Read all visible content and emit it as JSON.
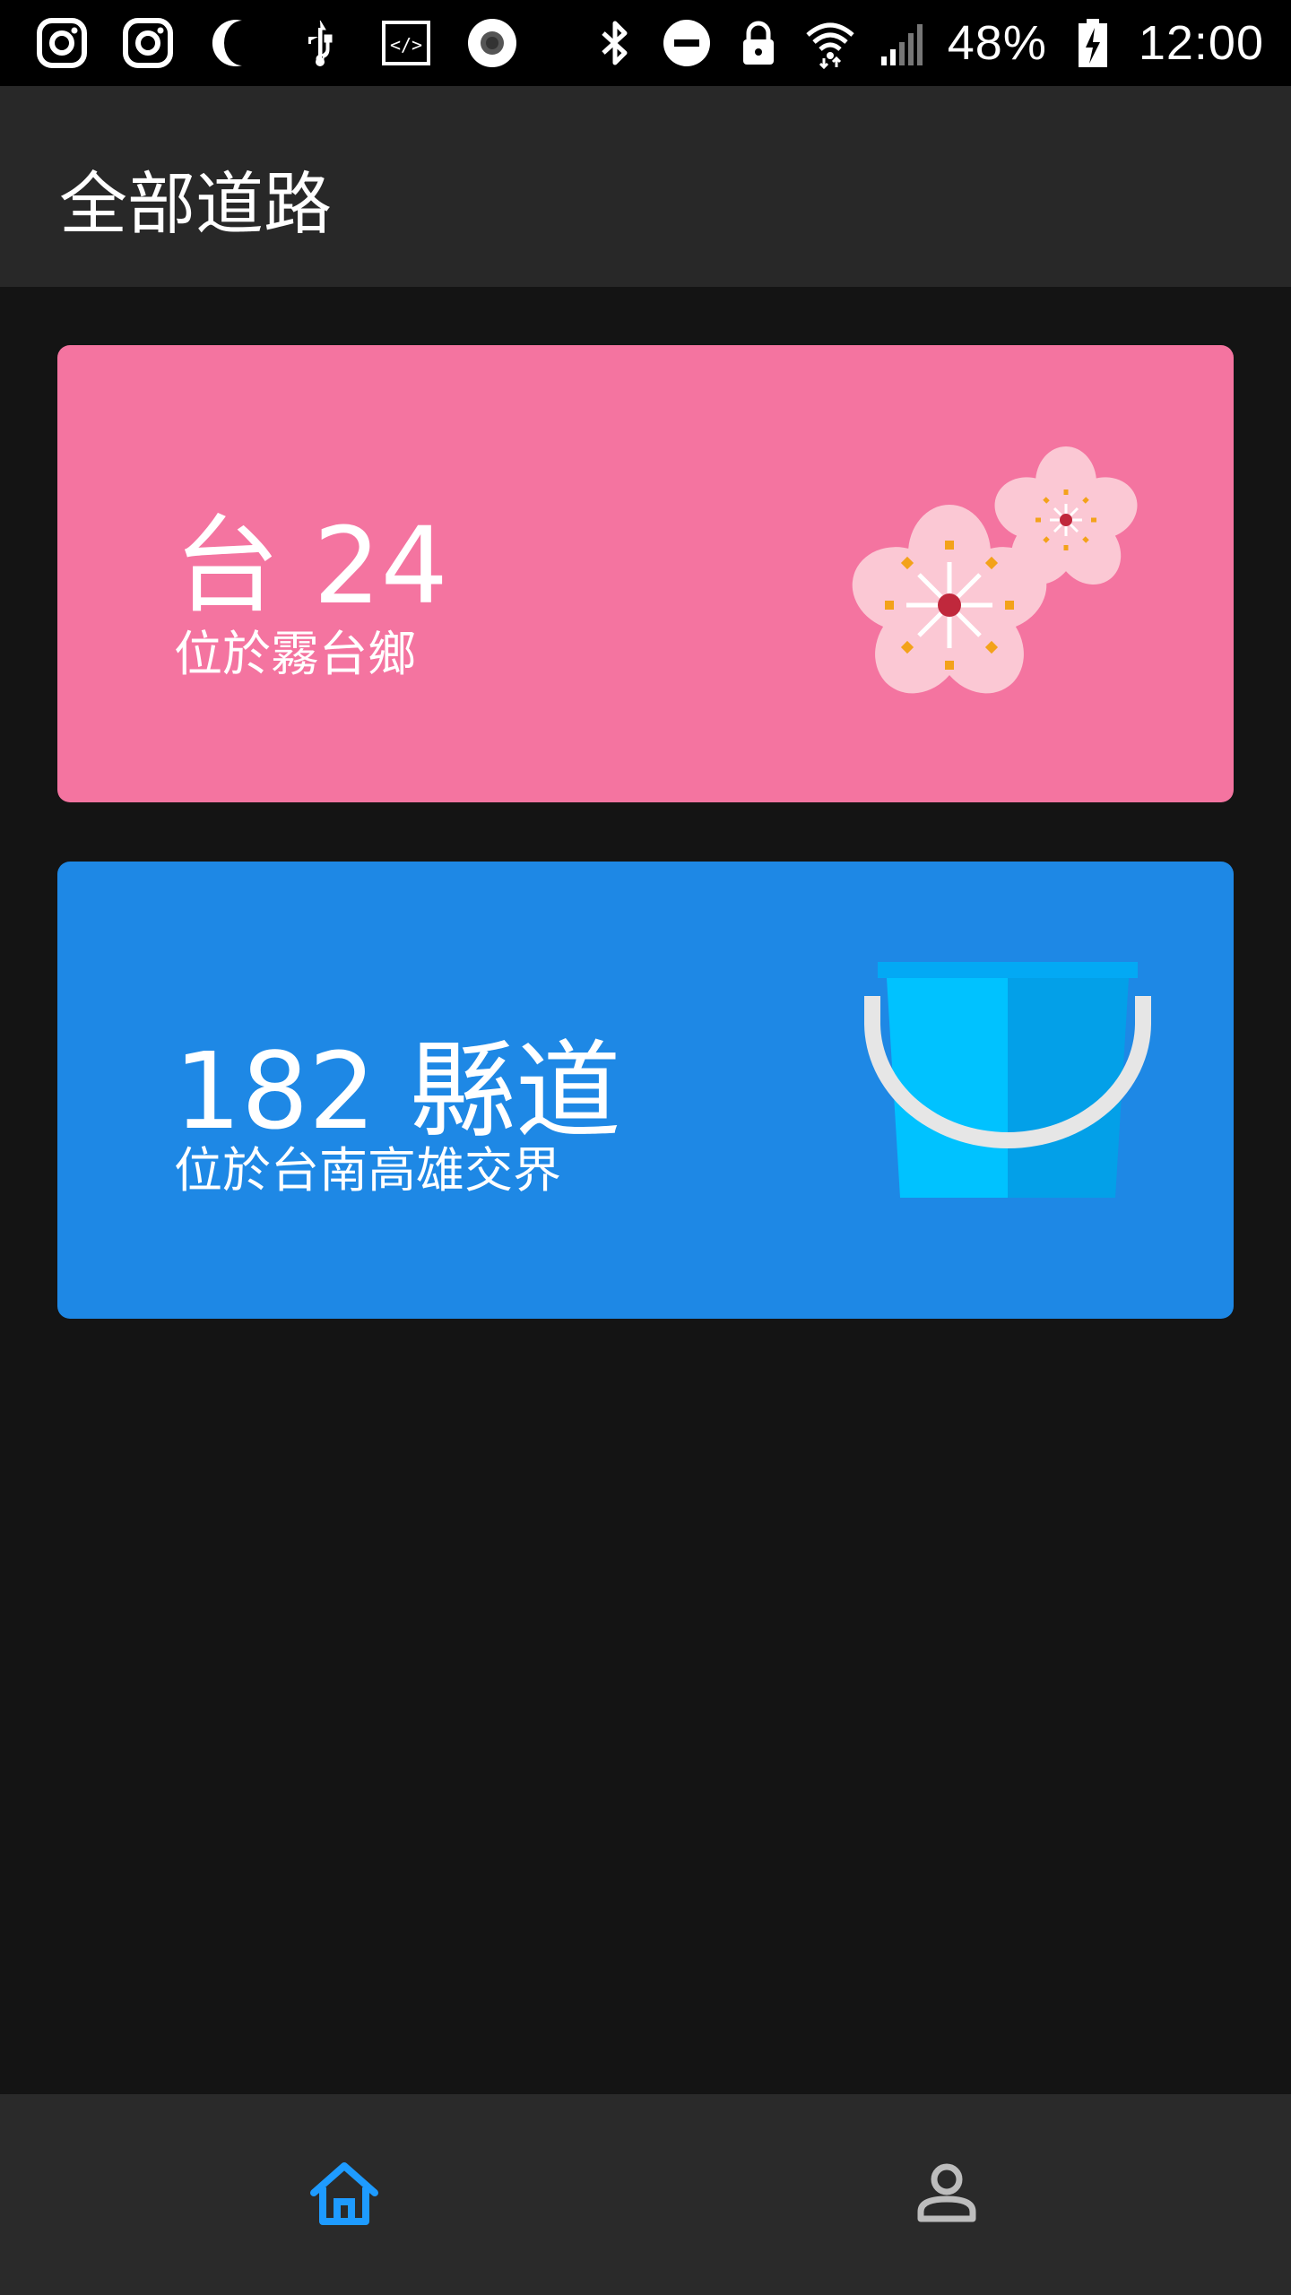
{
  "status_bar": {
    "left_icons": [
      "instagram-icon",
      "instagram-icon",
      "do-not-disturb-moon-icon",
      "usb-icon",
      "developer-code-icon",
      "record-icon"
    ],
    "right_icons": [
      "bluetooth-icon",
      "minus-circle-icon",
      "lock-icon",
      "wifi-icon",
      "cell-signal-icon"
    ],
    "battery": "48%",
    "time": "12:00"
  },
  "appbar": {
    "title": "全部道路"
  },
  "cards": [
    {
      "title": "台 24",
      "subtitle": "位於霧台鄉",
      "background": "#f474a0",
      "illustration": "cherry-blossom-icon"
    },
    {
      "title": "182 縣道",
      "subtitle": "位於台南高雄交界",
      "background": "#1e88e5",
      "illustration": "bucket-icon"
    }
  ],
  "bottom_nav": {
    "items": [
      {
        "icon": "home-icon",
        "active": true,
        "color": "#1e9bff"
      },
      {
        "icon": "person-icon",
        "active": false,
        "color": "#bdbdbd"
      }
    ]
  }
}
